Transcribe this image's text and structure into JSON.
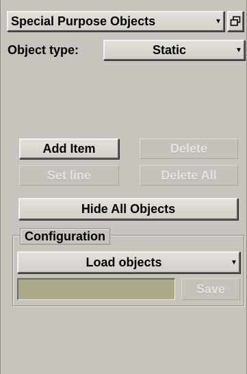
{
  "header": {
    "dropdown_label": "Special Purpose Objects",
    "dropdown_arrow_icon": "chevron-down-icon",
    "float_icon": "window-restore-icon"
  },
  "object_type": {
    "label": "Object type:",
    "selected": "Static",
    "arrow_icon": "chevron-down-icon"
  },
  "actions": {
    "add_item": "Add Item",
    "delete": "Delete",
    "set_line": "Set line",
    "delete_all": "Delete All",
    "hide_all": "Hide All Objects"
  },
  "configuration": {
    "title": "Configuration",
    "load_dropdown": "Load objects",
    "arrow_icon": "chevron-down-icon",
    "name_value": "",
    "save": "Save"
  }
}
